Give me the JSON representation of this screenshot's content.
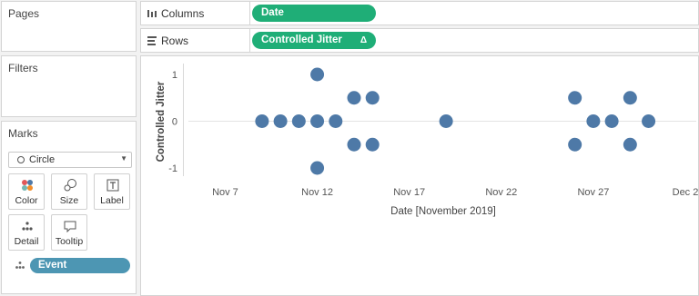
{
  "sidebar": {
    "pages_title": "Pages",
    "filters_title": "Filters",
    "marks": {
      "title": "Marks",
      "mark_type": "Circle",
      "buttons": [
        {
          "label": "Color",
          "icon": "color-icon"
        },
        {
          "label": "Size",
          "icon": "size-icon"
        },
        {
          "label": "Label",
          "icon": "label-icon"
        },
        {
          "label": "Detail",
          "icon": "detail-icon"
        },
        {
          "label": "Tooltip",
          "icon": "tooltip-icon"
        }
      ],
      "detail_field": "Event"
    }
  },
  "shelves": {
    "columns_label": "Columns",
    "columns_pill": "Date",
    "rows_label": "Rows",
    "rows_pill": "Controlled Jitter",
    "rows_pill_badge": "Δ"
  },
  "colors": {
    "accent_green": "#1fae77",
    "detail_pill_blue": "#4d96b3",
    "mark_blue": "#4e79a7"
  },
  "chart_data": {
    "type": "scatter",
    "xlabel": "Date [November 2019]",
    "ylabel": "Controlled Jitter",
    "x_tick_labels": [
      "Nov 7",
      "Nov 12",
      "Nov 17",
      "Nov 22",
      "Nov 27",
      "Dec 2"
    ],
    "y_tick_labels": [
      "1",
      "0",
      "-1"
    ],
    "xlim": [
      "2019-11-05",
      "2019-12-02"
    ],
    "ylim": [
      -1.2,
      1.2
    ],
    "points": [
      {
        "x": "2019-11-09",
        "y": 0
      },
      {
        "x": "2019-11-10",
        "y": 0
      },
      {
        "x": "2019-11-11",
        "y": 0
      },
      {
        "x": "2019-11-12",
        "y": 1
      },
      {
        "x": "2019-11-12",
        "y": 0
      },
      {
        "x": "2019-11-12",
        "y": -1
      },
      {
        "x": "2019-11-13",
        "y": 0
      },
      {
        "x": "2019-11-14",
        "y": 0.5
      },
      {
        "x": "2019-11-14",
        "y": -0.5
      },
      {
        "x": "2019-11-15",
        "y": 0.5
      },
      {
        "x": "2019-11-15",
        "y": -0.5
      },
      {
        "x": "2019-11-19",
        "y": 0
      },
      {
        "x": "2019-11-26",
        "y": 0.5
      },
      {
        "x": "2019-11-26",
        "y": -0.5
      },
      {
        "x": "2019-11-27",
        "y": 0
      },
      {
        "x": "2019-11-28",
        "y": 0
      },
      {
        "x": "2019-11-29",
        "y": 0.5
      },
      {
        "x": "2019-11-29",
        "y": -0.5
      },
      {
        "x": "2019-11-30",
        "y": 0
      }
    ],
    "grid": "horizontal zero line"
  }
}
